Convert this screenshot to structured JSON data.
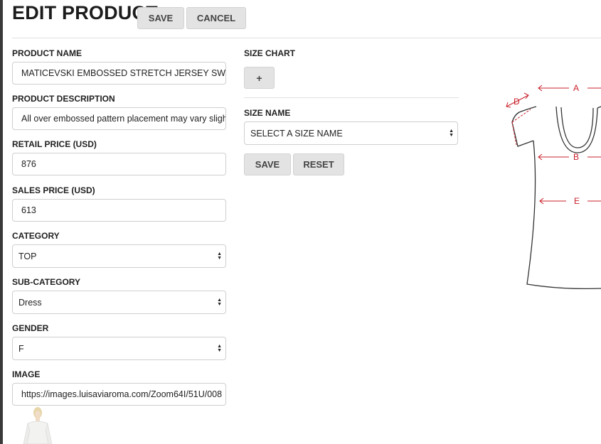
{
  "header": {
    "title": "EDIT PRODUCT",
    "save_label": "SAVE",
    "cancel_label": "CANCEL"
  },
  "form": {
    "product_name": {
      "label": "PRODUCT NAME",
      "value": "MATICEVSKI EMBOSSED STRETCH JERSEY SWEAT"
    },
    "product_description": {
      "label": "PRODUCT DESCRIPTION",
      "value": "All over embossed pattern placement may vary sligh"
    },
    "retail_price": {
      "label": "RETAIL PRICE (USD)",
      "value": "876"
    },
    "sales_price": {
      "label": "SALES PRICE (USD)",
      "value": "613"
    },
    "category": {
      "label": "CATEGORY",
      "value": "TOP"
    },
    "sub_category": {
      "label": "SUB-CATEGORY",
      "value": "Dress"
    },
    "gender": {
      "label": "GENDER",
      "value": "F"
    },
    "image": {
      "label": "IMAGE",
      "value": "https://images.luisaviaroma.com/Zoom64I/51U/008"
    }
  },
  "size_chart": {
    "title": "SIZE CHART",
    "add_label": "+",
    "size_name_label": "SIZE NAME",
    "size_name_value": "SELECT A SIZE NAME",
    "save_label": "SAVE",
    "reset_label": "RESET"
  },
  "diagram": {
    "labels": [
      "A",
      "B",
      "D",
      "E"
    ],
    "color": "#c8202a"
  }
}
